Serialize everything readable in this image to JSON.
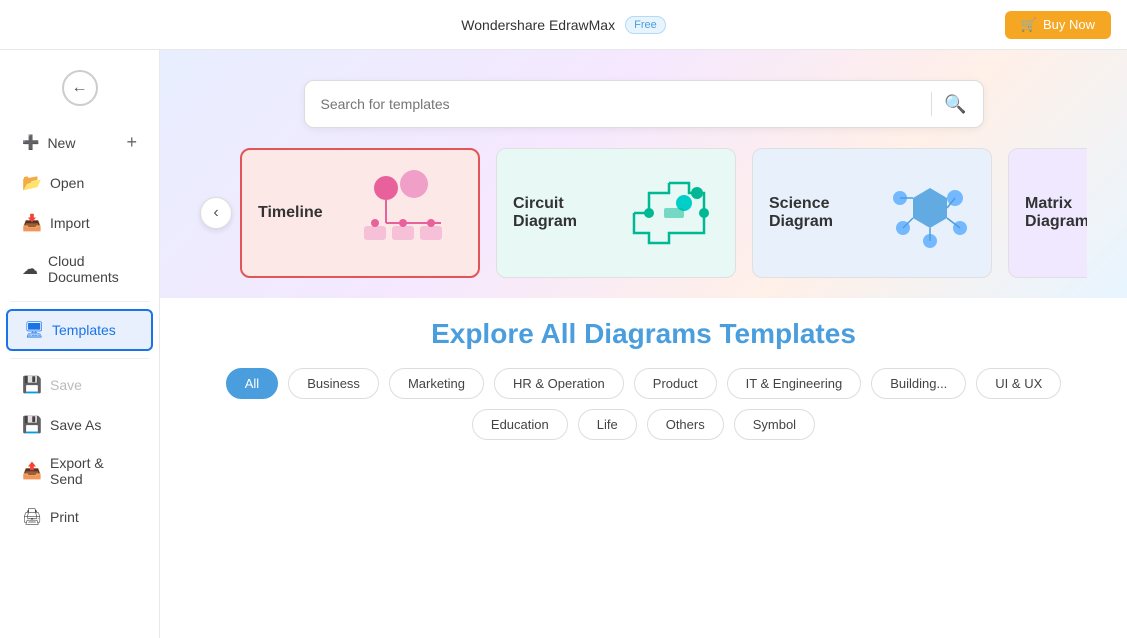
{
  "topbar": {
    "title": "Wondershare EdrawMax",
    "badge": "Free",
    "buy_label": "Buy Now"
  },
  "sidebar": {
    "back_label": "←",
    "items": [
      {
        "id": "new",
        "label": "New",
        "icon": "➕",
        "show_plus": true
      },
      {
        "id": "open",
        "label": "Open",
        "icon": "📂"
      },
      {
        "id": "import",
        "label": "Import",
        "icon": "📥"
      },
      {
        "id": "cloud-documents",
        "label": "Cloud Documents",
        "icon": "☁"
      },
      {
        "id": "templates",
        "label": "Templates",
        "icon": "🖥",
        "active": true
      },
      {
        "id": "save",
        "label": "Save",
        "icon": "💾",
        "disabled": true
      },
      {
        "id": "save-as",
        "label": "Save As",
        "icon": "💾"
      },
      {
        "id": "export-send",
        "label": "Export & Send",
        "icon": "📤"
      },
      {
        "id": "print",
        "label": "Print",
        "icon": "🖨"
      }
    ]
  },
  "search": {
    "placeholder": "Search for templates"
  },
  "template_cards": [
    {
      "id": "timeline",
      "label": "Timeline",
      "color": "pink"
    },
    {
      "id": "circuit-diagram",
      "label": "Circuit Diagram",
      "color": "teal"
    },
    {
      "id": "science-diagram",
      "label": "Science Diagram",
      "color": "blue"
    },
    {
      "id": "matrix-diagram",
      "label": "Matrix Diagram",
      "color": "purple"
    }
  ],
  "explore": {
    "title_plain": "Explore ",
    "title_colored": "All Diagrams Templates",
    "filters": [
      {
        "id": "all",
        "label": "All",
        "active": true
      },
      {
        "id": "business",
        "label": "Business"
      },
      {
        "id": "marketing",
        "label": "Marketing"
      },
      {
        "id": "hr-operation",
        "label": "HR & Operation"
      },
      {
        "id": "product",
        "label": "Product"
      },
      {
        "id": "it-engineering",
        "label": "IT & Engineering"
      },
      {
        "id": "building",
        "label": "Building..."
      },
      {
        "id": "ui-ux",
        "label": "UI & UX"
      },
      {
        "id": "education",
        "label": "Education"
      },
      {
        "id": "life",
        "label": "Life"
      },
      {
        "id": "others",
        "label": "Others"
      },
      {
        "id": "symbol",
        "label": "Symbol"
      }
    ]
  }
}
